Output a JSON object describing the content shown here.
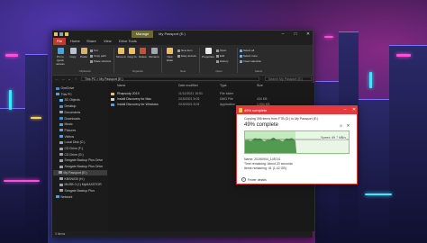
{
  "explorer": {
    "manage_tab": "Manage",
    "title": "My Passport (E:)",
    "menu": [
      "File",
      "Home",
      "Share",
      "View",
      "Drive Tools"
    ],
    "ribbon": {
      "pin_label": "Pin to Quick access",
      "copy_label": "Copy",
      "paste_label": "Paste",
      "cut_label": "Cut",
      "copy_path_label": "Copy path",
      "paste_shortcut_label": "Paste shortcut",
      "move_to_label": "Move to",
      "copy_to_label": "Copy to",
      "delete_label": "Delete",
      "rename_label": "Rename",
      "new_folder_label": "New folder",
      "new_item_label": "New item",
      "easy_access_label": "Easy access",
      "properties_label": "Properties",
      "open_label": "Open",
      "edit_label": "Edit",
      "history_label": "History",
      "select_all_label": "Select all",
      "select_none_label": "Select none",
      "invert_selection_label": "Invert selection",
      "groups": [
        "Clipboard",
        "Organize",
        "New",
        "Open",
        "Select"
      ]
    },
    "address": {
      "path": "This PC  >  My Passport (E:)",
      "search_placeholder": "Search My Passport (E:)"
    },
    "nav": [
      {
        "label": "OneDrive",
        "color": "#3a8ee6"
      },
      {
        "label": "This PC",
        "color": "#4aa3df"
      },
      {
        "label": "3D Objects",
        "color": "#6db3f2"
      },
      {
        "label": "Desktop",
        "color": "#4a90d9"
      },
      {
        "label": "Documents",
        "color": "#8fa5b8"
      },
      {
        "label": "Downloads",
        "color": "#3b8fdc"
      },
      {
        "label": "Music",
        "color": "#5aa0e0"
      },
      {
        "label": "Pictures",
        "color": "#5aa0e0"
      },
      {
        "label": "Videos",
        "color": "#5aa0e0"
      },
      {
        "label": "Local Disk (C:)",
        "color": "#9aa4ad"
      },
      {
        "label": "CD Drive (F:)",
        "color": "#9aa4ad"
      },
      {
        "label": "CD Drive (G:)",
        "color": "#9aa4ad"
      },
      {
        "label": "Seagate Backup Plus Drive",
        "color": "#9aa4ad"
      },
      {
        "label": "Seagate Backup Plus Drive",
        "color": "#9aa4ad"
      },
      {
        "label": "My Passport (E:)",
        "color": "#9aa4ad"
      },
      {
        "label": "KBSN030 (H:)",
        "color": "#9aa4ad"
      },
      {
        "label": "MUSB 0 (I:) MyMAXSTOR",
        "color": "#9aa4ad"
      },
      {
        "label": "Seagate Backup Plus",
        "color": "#9aa4ad"
      },
      {
        "label": "Network",
        "color": "#4aa3df"
      }
    ],
    "columns": [
      "Name",
      "Date modified",
      "Type",
      "Size"
    ],
    "files": [
      {
        "name": "Rhapsody 2019",
        "date": "11/12/2021 10:51",
        "type": "File folder",
        "size": "",
        "color": "#e8c15a"
      },
      {
        "name": "Install Discovery for Mac",
        "date": "2/15/2021 5:03",
        "type": "DMG File",
        "size": "434 KB",
        "color": "#d6d6d6"
      },
      {
        "name": "Install Discovery for Windows",
        "date": "2/15/2021 5:03",
        "type": "Application",
        "size": "1,904 KB",
        "color": "#4a9ee8"
      }
    ],
    "status": "3 items"
  },
  "copy_dialog": {
    "title": "49% complete",
    "copying_text": "Copying 396 items from  FTB (D:)  to  My Passport (E:)",
    "percent_text": "49% complete",
    "pause_glyph": "II",
    "cancel_glyph": "✕",
    "progress": 0.49,
    "speed": "Speed: 69.7 MB/s",
    "name": "Name: 20190904_145741",
    "time_remaining": "Time remaining: About 20 seconds",
    "items_remaining": "Items remaining: 41 (1.42 GB)",
    "fewer_details": "Fewer details",
    "graph_color": "#3c8c3c"
  }
}
